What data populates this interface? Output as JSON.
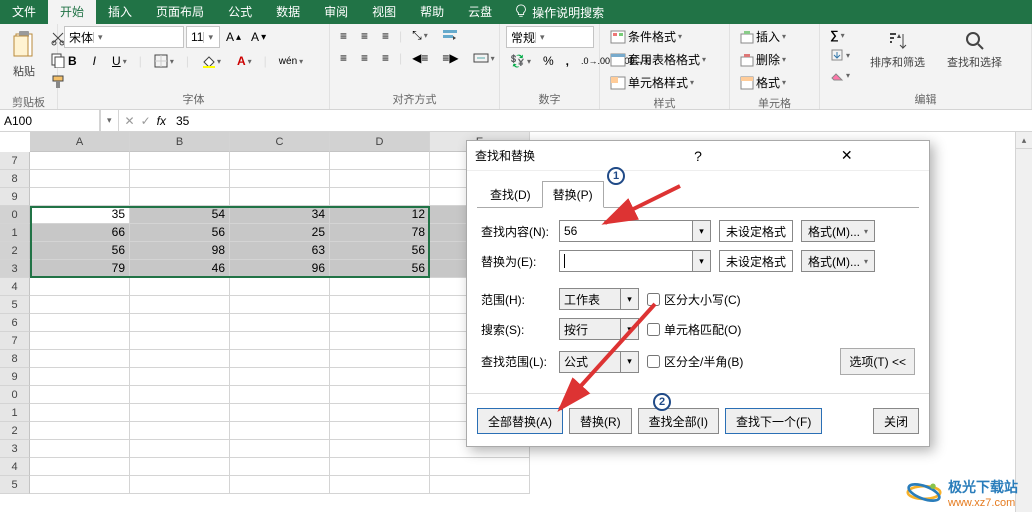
{
  "ribbon": {
    "tabs": [
      "文件",
      "开始",
      "插入",
      "页面布局",
      "公式",
      "数据",
      "审阅",
      "视图",
      "帮助",
      "云盘"
    ],
    "active_tab": "开始",
    "tell_me": "操作说明搜索",
    "groups": {
      "clipboard": {
        "label": "剪贴板",
        "paste": "粘贴"
      },
      "font": {
        "label": "字体",
        "name": "宋体",
        "size": "11"
      },
      "alignment": {
        "label": "对齐方式"
      },
      "number": {
        "label": "数字",
        "format": "常规"
      },
      "styles": {
        "label": "样式",
        "cond": "条件格式",
        "table": "套用表格格式",
        "cell": "单元格样式"
      },
      "cells": {
        "label": "单元格",
        "insert": "插入",
        "delete": "删除",
        "format": "格式"
      },
      "editing": {
        "label": "编辑",
        "sort": "排序和筛选",
        "find": "查找和选择"
      }
    }
  },
  "formula_bar": {
    "name_box": "A100",
    "fx": "fx",
    "value": "35"
  },
  "grid": {
    "columns": [
      "A",
      "B",
      "C",
      "D",
      "E"
    ],
    "row_start": 7,
    "rows": [
      {
        "n": 7,
        "c": [
          "",
          "",
          "",
          "",
          ""
        ]
      },
      {
        "n": 8,
        "c": [
          "",
          "",
          "",
          "",
          ""
        ]
      },
      {
        "n": 9,
        "c": [
          "",
          "",
          "",
          "",
          ""
        ]
      },
      {
        "n": 0,
        "c": [
          "35",
          "54",
          "34",
          "12",
          ""
        ],
        "sel": true
      },
      {
        "n": 1,
        "c": [
          "66",
          "56",
          "25",
          "78",
          ""
        ],
        "sel": true
      },
      {
        "n": 2,
        "c": [
          "56",
          "98",
          "63",
          "56",
          ""
        ],
        "sel": true
      },
      {
        "n": 3,
        "c": [
          "79",
          "46",
          "96",
          "56",
          ""
        ],
        "sel": true
      },
      {
        "n": 4,
        "c": [
          "",
          "",
          "",
          "",
          ""
        ]
      },
      {
        "n": 5,
        "c": [
          "",
          "",
          "",
          "",
          ""
        ]
      },
      {
        "n": 6,
        "c": [
          "",
          "",
          "",
          "",
          ""
        ]
      },
      {
        "n": 7,
        "c": [
          "",
          "",
          "",
          "",
          ""
        ]
      },
      {
        "n": 8,
        "c": [
          "",
          "",
          "",
          "",
          ""
        ]
      },
      {
        "n": 9,
        "c": [
          "",
          "",
          "",
          "",
          ""
        ]
      },
      {
        "n": 0,
        "c": [
          "",
          "",
          "",
          "",
          ""
        ]
      },
      {
        "n": 1,
        "c": [
          "",
          "",
          "",
          "",
          ""
        ]
      },
      {
        "n": 2,
        "c": [
          "",
          "",
          "",
          "",
          ""
        ]
      },
      {
        "n": 3,
        "c": [
          "",
          "",
          "",
          "",
          ""
        ]
      },
      {
        "n": 4,
        "c": [
          "",
          "",
          "",
          "",
          ""
        ]
      },
      {
        "n": 5,
        "c": [
          "",
          "",
          "",
          "",
          ""
        ]
      }
    ]
  },
  "dialog": {
    "title": "查找和替换",
    "tab_find": "查找(D)",
    "tab_replace": "替换(P)",
    "find_label": "查找内容(N):",
    "find_value": "56",
    "replace_label": "替换为(E):",
    "replace_value": "",
    "no_format": "未设定格式",
    "format_btn": "格式(M)...",
    "scope_label": "范围(H):",
    "scope_value": "工作表",
    "search_label": "搜索(S):",
    "search_value": "按行",
    "lookin_label": "查找范围(L):",
    "lookin_value": "公式",
    "match_case": "区分大小写(C)",
    "match_entire": "单元格匹配(O)",
    "match_width": "区分全/半角(B)",
    "options_btn": "选项(T) <<",
    "btn_replace_all": "全部替换(A)",
    "btn_replace": "替换(R)",
    "btn_find_all": "查找全部(I)",
    "btn_find_next": "查找下一个(F)",
    "btn_close": "关闭"
  },
  "watermark": {
    "text": "极光下载站",
    "url": "www.xz7.com"
  }
}
